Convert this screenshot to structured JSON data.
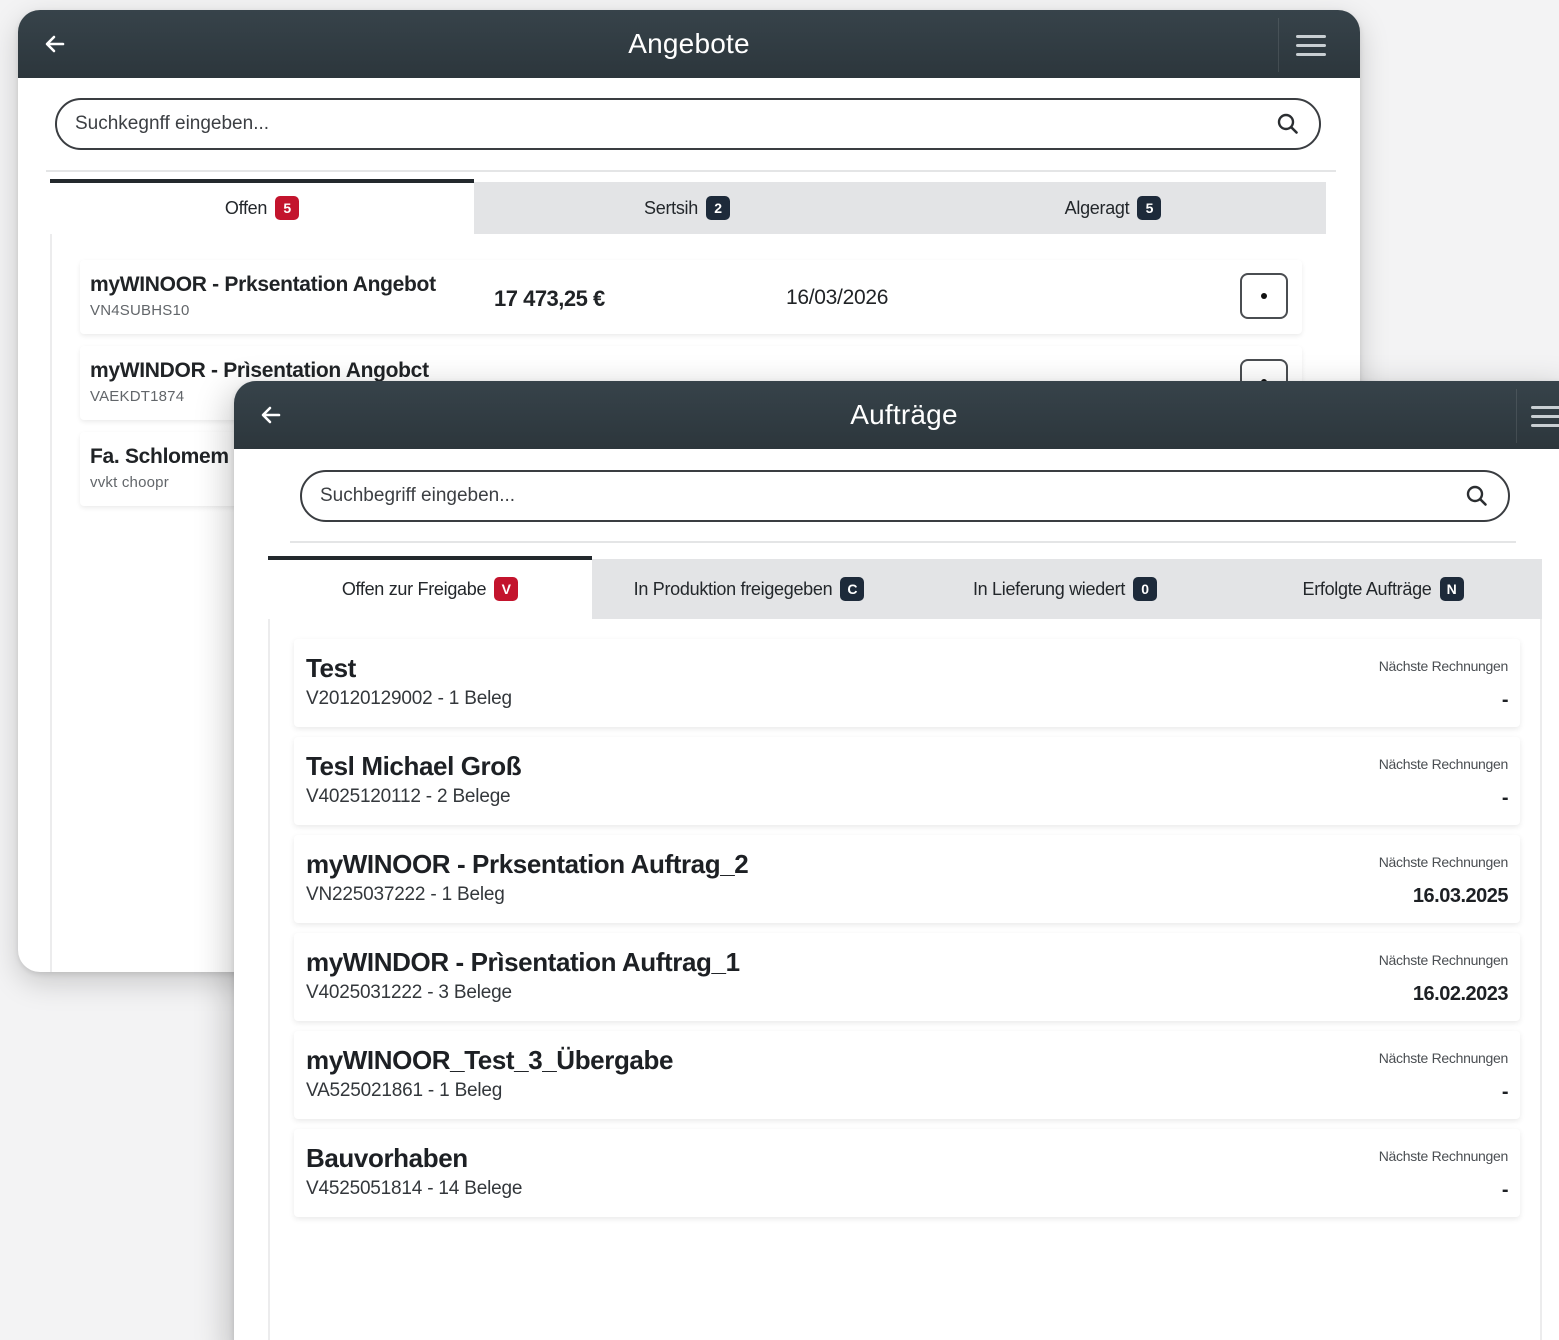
{
  "colors": {
    "titlebar": "#313b41",
    "badge_red": "#c3142d",
    "badge_dark": "#1d2a3a",
    "tab_inactive_bg": "#e3e4e6"
  },
  "back_window": {
    "title": "Angebote",
    "search": {
      "placeholder": "Suchkegnff eingeben..."
    },
    "tabs": [
      {
        "label": "Offen",
        "badge": "5",
        "badge_color": "#c3142d",
        "active": true
      },
      {
        "label": "Sertsih",
        "badge": "2",
        "badge_color": "#1d2a3a",
        "active": false
      },
      {
        "label": "Algeragt",
        "badge": "5",
        "badge_color": "#1d2a3a",
        "active": false
      }
    ],
    "rows": [
      {
        "name": "myWINOOR - Prksentation Angebot",
        "sub": "VN4SUBHS10",
        "amount": "17 473,25 €",
        "date": "16/03/2026"
      },
      {
        "name": "myWINDOR - Prìsentation Angobct",
        "sub": "VAEKDT1874",
        "amount": "",
        "date": ""
      },
      {
        "name": "Fa. Schlomem",
        "sub": "vvkt choopr",
        "amount": "",
        "date": ""
      }
    ]
  },
  "front_window": {
    "title": "Aufträge",
    "search": {
      "placeholder": "Suchbegriff eingeben..."
    },
    "tabs": [
      {
        "label": "Offen zur Freigabe",
        "badge": "V",
        "badge_color": "#c3142d",
        "active": true
      },
      {
        "label": "In Produktion freigegeben",
        "badge": "C",
        "badge_color": "#1d2a3a",
        "active": false
      },
      {
        "label": "In Lieferung wiedert",
        "badge": "0",
        "badge_color": "#1d2a3a",
        "active": false
      },
      {
        "label": "Erfolgte Aufträge",
        "badge": "N",
        "badge_color": "#1d2a3a",
        "active": false
      }
    ],
    "rows": [
      {
        "name": "Test",
        "sub": "V20120129002 - 1 Beleg",
        "meta_label": "Nächste Rechnungen",
        "meta_value": "-"
      },
      {
        "name": "Tesl Michael Groß",
        "sub": "V4025120112 - 2 Belege",
        "meta_label": "Nächste Rechnungen",
        "meta_value": "-"
      },
      {
        "name": "myWINOOR - Prksentation Auftrag_2",
        "sub": "VN225037222 - 1 Beleg",
        "meta_label": "Nächste Rechnungen",
        "meta_value": "16.03.2025"
      },
      {
        "name": "myWINDOR - Prìsentation Auftrag_1",
        "sub": "V4025031222 - 3 Belege",
        "meta_label": "Nächste Rechnungen",
        "meta_value": "16.02.2023"
      },
      {
        "name": "myWINOOR_Test_3_Übergabe",
        "sub": "VA525021861 - 1 Beleg",
        "meta_label": "Nächste Rechnungen",
        "meta_value": "-"
      },
      {
        "name": "Bauvorhaben",
        "sub": "V4525051814 - 14 Belege",
        "meta_label": "Nächste Rechnungen",
        "meta_value": "-"
      }
    ]
  },
  "icons": {
    "back": "arrow-left-icon",
    "menu": "hamburger-menu-icon",
    "search": "search-icon",
    "row_action": "more-dot-icon"
  }
}
